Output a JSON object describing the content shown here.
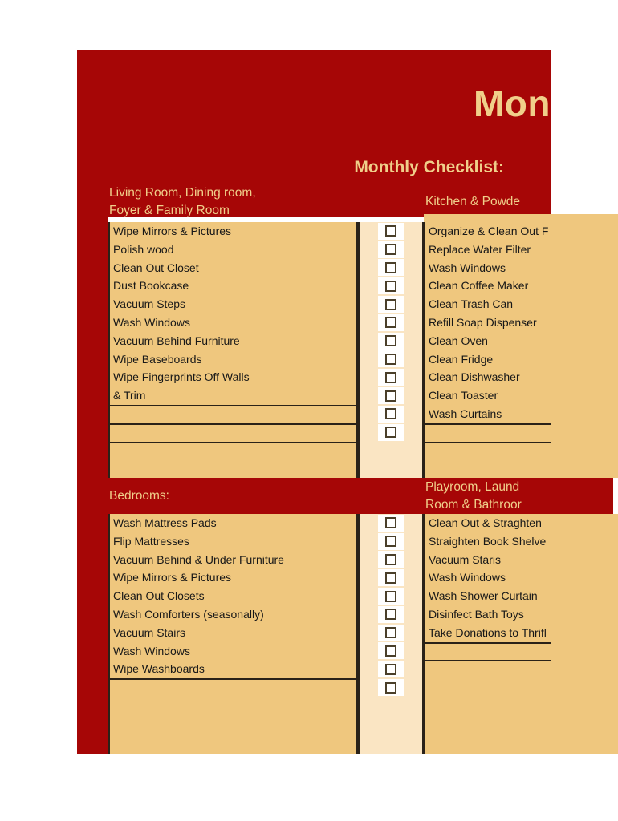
{
  "document": {
    "title": "Mon",
    "subtitle": "Monthly Checklist:"
  },
  "sections": [
    {
      "id": "living",
      "caption_line1": "Living Room, Dining room,",
      "caption_line2": "Foyer & Family Room",
      "items": [
        "Wipe Mirrors & Pictures",
        "Polish wood",
        "Clean Out Closet",
        "Dust Bookcase",
        "Vacuum Steps",
        "Wash Windows",
        "Vacuum Behind Furniture",
        "Wipe Baseboards",
        "Wipe Fingerprints Off Walls",
        " & Trim"
      ],
      "checkbox_count": 12,
      "blank_ruled_rows": 3
    },
    {
      "id": "kitchen",
      "caption_line1": "Kitchen & Powde",
      "caption_line2": "",
      "items": [
        "Organize & Clean Out F",
        "Replace Water Filter",
        "Wash Windows",
        "Clean Coffee Maker",
        "Clean Trash Can",
        "Refill Soap Dispenser",
        "Clean Oven",
        "Clean Fridge",
        "Clean Dishwasher",
        "Clean Toaster",
        "Wash Curtains"
      ],
      "blank_ruled_rows": 2
    },
    {
      "id": "bedrooms",
      "caption_line1": "Bedrooms:",
      "caption_line2": "",
      "items": [
        "Wash Mattress Pads",
        "Flip Mattresses",
        "Vacuum Behind & Under Furniture",
        "Wipe Mirrors & Pictures",
        "Clean Out Closets",
        "Wash Comforters (seasonally)",
        "Vacuum Stairs",
        "Wash Windows",
        "Wipe Washboards"
      ],
      "checkbox_count": 10,
      "blank_ruled_rows": 1
    },
    {
      "id": "playroom",
      "caption_line1": "Playroom, Laund",
      "caption_line2": "Room & Bathroor",
      "items": [
        "Clean Out & Straghten",
        "Straighten Book Shelve",
        "Vacuum Staris",
        "Wash Windows",
        "Wash Shower Curtain",
        "Disinfect Bath Toys",
        "Take Donations to Thrifl"
      ],
      "blank_ruled_rows": 2
    }
  ],
  "colors": {
    "banner_red": "#A60606",
    "banner_text": "#F0CF8A",
    "list_tan": "#EFC77E",
    "check_cream": "#FAE5C3",
    "rule_dark": "#2a2218",
    "checkbox_border": "#4a3f2a",
    "item_text": "#181818"
  }
}
